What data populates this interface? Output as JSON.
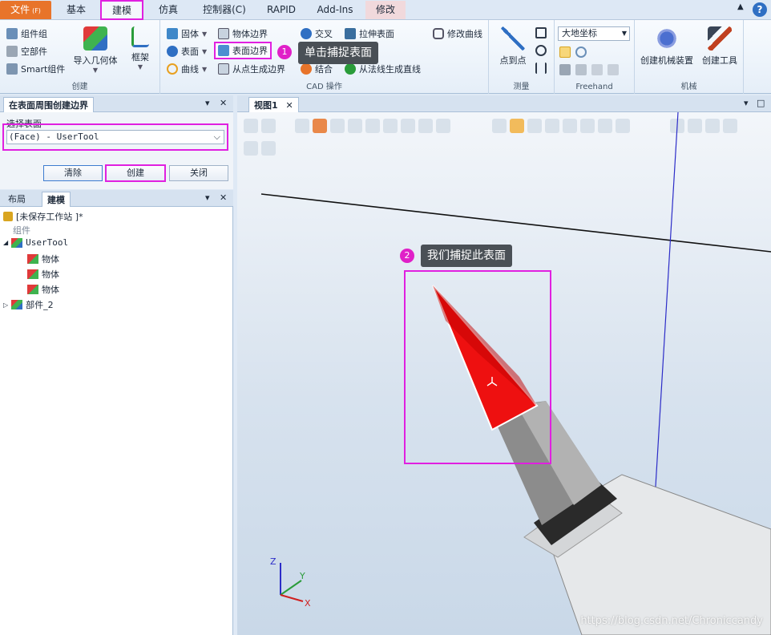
{
  "menu": {
    "file": "文件",
    "file_key": "(F)",
    "tabs": [
      "基本",
      "建模",
      "仿真",
      "控制器(C)",
      "RAPID",
      "Add-Ins",
      "修改"
    ]
  },
  "ribbon": {
    "create": {
      "items": [
        "组件组",
        "空部件",
        "Smart组件"
      ],
      "import_geom": "导入几何体",
      "frame": "框架",
      "label": "创建"
    },
    "cad": {
      "col1": [
        "固体",
        "表面",
        "曲线"
      ],
      "col2": [
        "物体边界",
        "表面边界",
        "从点生成边界"
      ],
      "col3": [
        "交叉",
        "拉伸表面",
        "结合"
      ],
      "col4": [
        "修改曲线",
        "从法线生成直线"
      ],
      "label": "CAD 操作"
    },
    "measure": {
      "point_to_point": "点到点",
      "label": "测量"
    },
    "freehand": {
      "coord": "大地坐标",
      "label": "Freehand"
    },
    "mech": {
      "create_mech": "创建机械装置",
      "create_tool": "创建工具",
      "label": "机械"
    }
  },
  "callouts": {
    "c1_num": "1",
    "c1_text": "单击捕捉表面",
    "c2_num": "2",
    "c2_text": "我们捕捉此表面"
  },
  "boundary_panel": {
    "title": "在表面周围创建边界",
    "select_label": "选择表面",
    "select_value": "(Face) - UserTool",
    "clear": "清除",
    "create": "创建",
    "close": "关闭"
  },
  "tree_panel": {
    "tabs": [
      "布局",
      "建模"
    ],
    "station": "[未保存工作站 ]*",
    "group": "组件",
    "usertool": "UserTool",
    "bodies": [
      "物体",
      "物体",
      "物体"
    ],
    "part2": "部件_2"
  },
  "viewport": {
    "tab": "视图1"
  },
  "axes": {
    "x": "X",
    "y": "Y",
    "z": "Z"
  },
  "watermark": "https://blog.csdn.net/Chroniccandy"
}
